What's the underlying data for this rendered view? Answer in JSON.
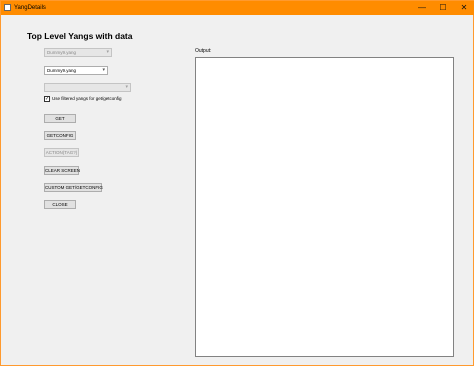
{
  "window": {
    "title": "YangDetails",
    "controls": {
      "minimize": "—",
      "maximize": "☐",
      "close": "✕"
    },
    "title_bar_color": "#ff8c00"
  },
  "heading": "Top Level Yangs with data",
  "dropdowns": {
    "first": {
      "value": "Dummy9.yang",
      "disabled": true
    },
    "second": {
      "value": "Dummy9.yang",
      "disabled": false
    },
    "third": {
      "value": "",
      "disabled": true
    },
    "arrow_icon": "chevron-down-icon"
  },
  "checkbox": {
    "label": "Use filtered yangs for get/getconfig",
    "checked": true,
    "mark": "✓"
  },
  "buttons": {
    "get": "GET",
    "getconfig": "GETCONFIG",
    "action": "ACTION(TAG?)",
    "clear_screen": "CLEAR SCREEN",
    "custom": "CUSTOM GET/GETCONFIG",
    "close": "CLOSE"
  },
  "output": {
    "label": "Output:",
    "text": ""
  }
}
